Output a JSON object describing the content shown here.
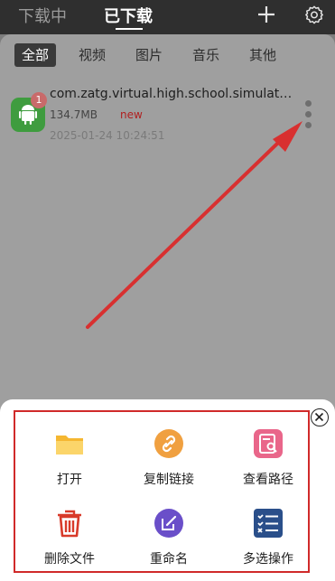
{
  "header": {
    "tabs": [
      {
        "label": "下载中",
        "active": false
      },
      {
        "label": "已下载",
        "active": true
      }
    ]
  },
  "filters": [
    {
      "label": "全部",
      "active": true
    },
    {
      "label": "视频",
      "active": false
    },
    {
      "label": "图片",
      "active": false
    },
    {
      "label": "音乐",
      "active": false
    },
    {
      "label": "其他",
      "active": false
    }
  ],
  "file": {
    "icon": "android-icon",
    "badge": "1",
    "name": "com.zatg.virtual.high.school.simulator.apk",
    "size": "134.7MB",
    "tag": "new",
    "date": "2025-01-24 10:24:51"
  },
  "sheet": {
    "actions": [
      {
        "label": "打开",
        "icon": "folder-icon",
        "color": "#f5b731"
      },
      {
        "label": "复制链接",
        "icon": "link-icon",
        "color": "#f0a040"
      },
      {
        "label": "查看路径",
        "icon": "path-icon",
        "color": "#e9668a"
      },
      {
        "label": "删除文件",
        "icon": "trash-icon",
        "color": "#d83a2a"
      },
      {
        "label": "重命名",
        "icon": "rename-icon",
        "color": "#6a4fc9"
      },
      {
        "label": "多选操作",
        "icon": "list-check-icon",
        "color": "#2a4f8a"
      }
    ]
  },
  "colors": {
    "header_bg": "#2f2f2f",
    "overlay": "#9f9f9f",
    "annotation": "#d02a2a"
  }
}
